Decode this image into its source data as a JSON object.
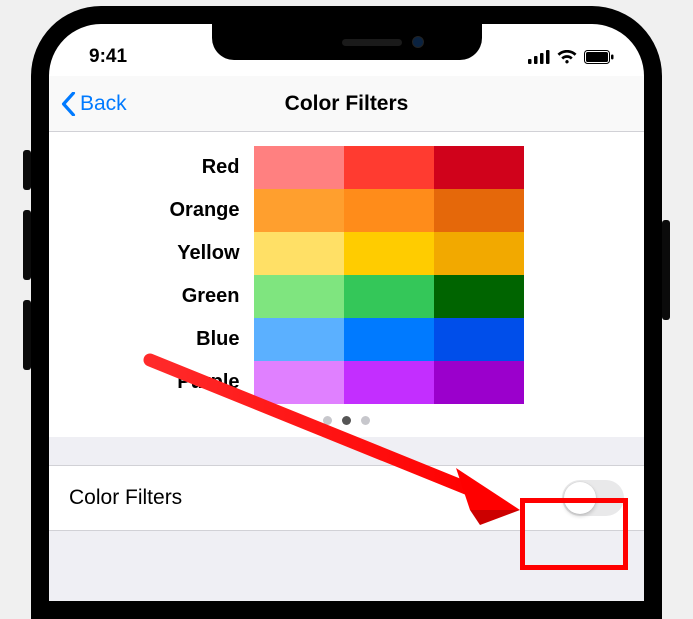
{
  "status_bar": {
    "time": "9:41"
  },
  "nav": {
    "back_label": "Back",
    "title": "Color Filters"
  },
  "preview": {
    "rows": [
      {
        "label": "Red",
        "colors": [
          "#ff8080",
          "#ff3b30",
          "#d0021b"
        ]
      },
      {
        "label": "Orange",
        "colors": [
          "#ff9f2e",
          "#ff8c1a",
          "#e5680a"
        ]
      },
      {
        "label": "Yellow",
        "colors": [
          "#ffe066",
          "#ffcc00",
          "#f2a900"
        ]
      },
      {
        "label": "Green",
        "colors": [
          "#7fe57f",
          "#34c759",
          "#006400"
        ]
      },
      {
        "label": "Blue",
        "colors": [
          "#5bb0ff",
          "#007aff",
          "#004eea"
        ]
      },
      {
        "label": "Purple",
        "colors": [
          "#e080ff",
          "#c32eff",
          "#9b00cc"
        ]
      }
    ],
    "page_index": 1,
    "page_count": 3
  },
  "setting": {
    "label": "Color Filters",
    "on": false
  }
}
